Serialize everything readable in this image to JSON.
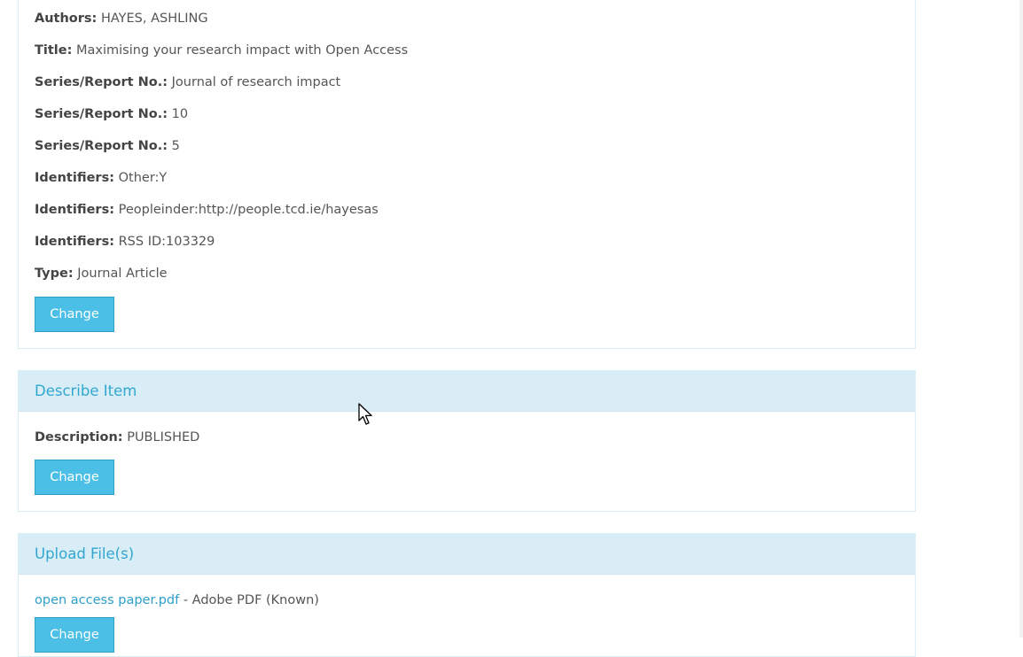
{
  "item_summary": {
    "fields": [
      {
        "label": "Authors:",
        "value": "HAYES, ASHLING"
      },
      {
        "label": "Title:",
        "value": "Maximising your research impact with Open Access"
      },
      {
        "label": "Series/Report No.:",
        "value": "Journal of research impact"
      },
      {
        "label": "Series/Report No.:",
        "value": "10"
      },
      {
        "label": "Series/Report No.:",
        "value": "5"
      },
      {
        "label": "Identifiers:",
        "value": "Other:Y"
      },
      {
        "label": "Identifiers:",
        "value": "Peopleinder:http://people.tcd.ie/hayesas"
      },
      {
        "label": "Identifiers:",
        "value": "RSS ID:103329"
      },
      {
        "label": "Type:",
        "value": "Journal Article"
      }
    ],
    "change_label": "Change"
  },
  "describe_item": {
    "heading": "Describe Item",
    "description_label": "Description:",
    "description_value": "PUBLISHED",
    "change_label": "Change"
  },
  "upload_files": {
    "heading": "Upload File(s)",
    "file_name": "open access paper.pdf",
    "file_format": "- Adobe PDF (Known)",
    "change_label": "Change"
  },
  "colors": {
    "panel_heading_bg": "#d9edf7",
    "heading_text": "#31a7d0",
    "button_bg": "#4bbfe6",
    "link": "#2d9fc9"
  },
  "icons": {
    "pointer": "mouse-pointer-icon"
  }
}
